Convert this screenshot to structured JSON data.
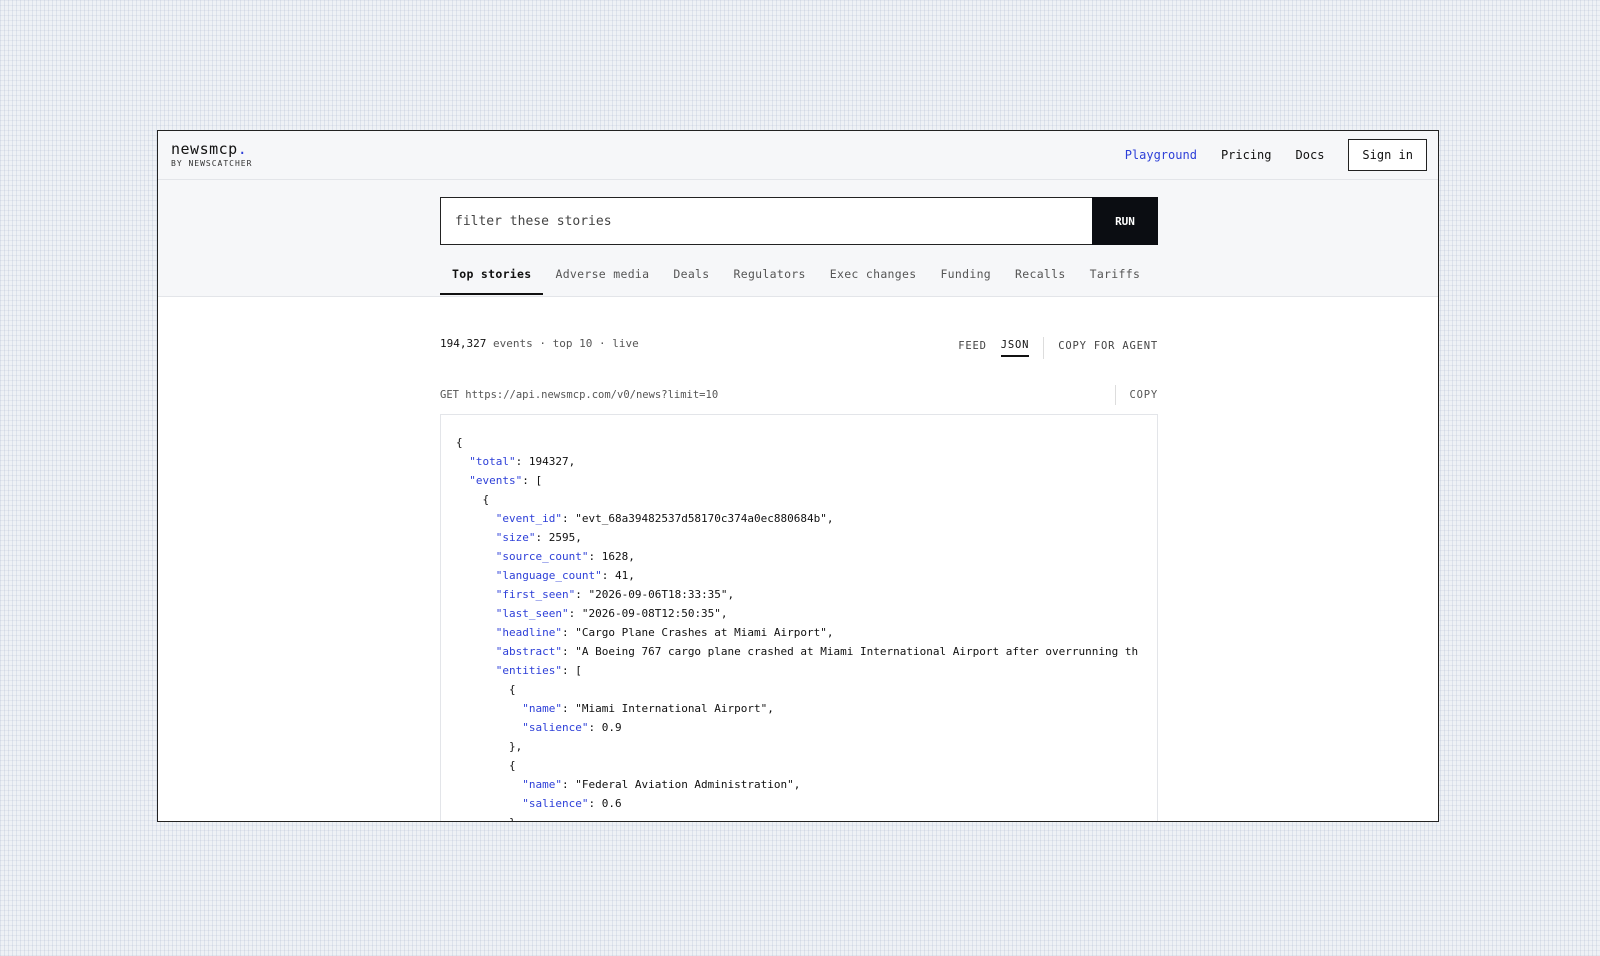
{
  "header": {
    "logo_name": "newsmcp",
    "logo_dot": ".",
    "logo_sub": "BY NEWSCATCHER",
    "nav": [
      "Playground",
      "Pricing",
      "Docs"
    ],
    "signin_label": "Sign in"
  },
  "search": {
    "placeholder": "filter these stories",
    "value": "",
    "run_label": "RUN"
  },
  "tabs": [
    "Top stories",
    "Adverse media",
    "Deals",
    "Regulators",
    "Exec changes",
    "Funding",
    "Recalls",
    "Tariffs"
  ],
  "stats": {
    "count": "194,327",
    "events_label": "events",
    "sep1": " · ",
    "top": "top 10",
    "sep2": " · ",
    "live": "live"
  },
  "view_toggle": {
    "feed": "FEED",
    "json": "JSON",
    "copy_for_agent": "COPY FOR AGENT"
  },
  "endpoint": {
    "method_url": "GET https://api.newsmcp.com/v0/news?limit=10",
    "copy_label": "COPY"
  },
  "json_lines": [
    {
      "indent": 0,
      "key": null,
      "value": "{"
    },
    {
      "indent": 1,
      "key": "\"total\"",
      "value": ": 194327,"
    },
    {
      "indent": 1,
      "key": "\"events\"",
      "value": ": ["
    },
    {
      "indent": 2,
      "key": null,
      "value": "{"
    },
    {
      "indent": 3,
      "key": "\"event_id\"",
      "value": ": \"evt_68a39482537d58170c374a0ec880684b\","
    },
    {
      "indent": 3,
      "key": "\"size\"",
      "value": ": 2595,"
    },
    {
      "indent": 3,
      "key": "\"source_count\"",
      "value": ": 1628,"
    },
    {
      "indent": 3,
      "key": "\"language_count\"",
      "value": ": 41,"
    },
    {
      "indent": 3,
      "key": "\"first_seen\"",
      "value": ": \"2026-09-06T18:33:35\","
    },
    {
      "indent": 3,
      "key": "\"last_seen\"",
      "value": ": \"2026-09-08T12:50:35\","
    },
    {
      "indent": 3,
      "key": "\"headline\"",
      "value": ": \"Cargo Plane Crashes at Miami Airport\","
    },
    {
      "indent": 3,
      "key": "\"abstract\"",
      "value": ": \"A Boeing 767 cargo plane crashed at Miami International Airport after overrunning th"
    },
    {
      "indent": 3,
      "key": "\"entities\"",
      "value": ": ["
    },
    {
      "indent": 4,
      "key": null,
      "value": "{"
    },
    {
      "indent": 5,
      "key": "\"name\"",
      "value": ": \"Miami International Airport\","
    },
    {
      "indent": 5,
      "key": "\"salience\"",
      "value": ": 0.9"
    },
    {
      "indent": 4,
      "key": null,
      "value": "},"
    },
    {
      "indent": 4,
      "key": null,
      "value": "{"
    },
    {
      "indent": 5,
      "key": "\"name\"",
      "value": ": \"Federal Aviation Administration\","
    },
    {
      "indent": 5,
      "key": "\"salience\"",
      "value": ": 0.6"
    },
    {
      "indent": 4,
      "key": null,
      "value": "}"
    }
  ],
  "colors": {
    "accent": "#2d3fd8",
    "run_bg": "#0b0d12"
  }
}
